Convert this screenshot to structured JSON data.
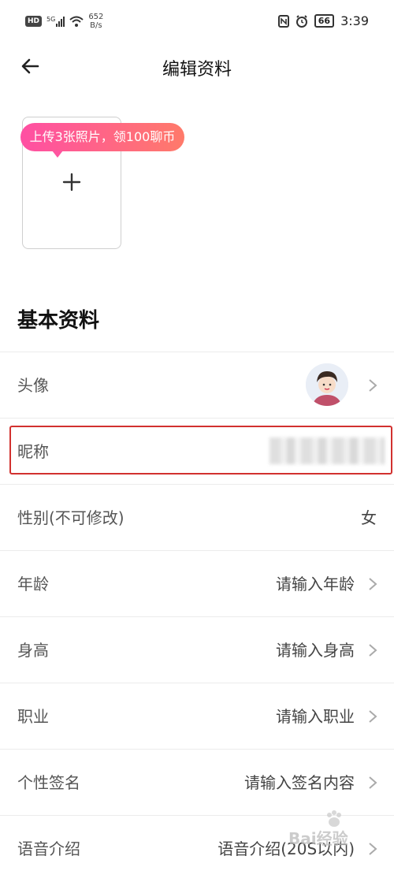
{
  "status_bar": {
    "hd_badge": "HD",
    "network": "5G",
    "speed_value": "652",
    "speed_unit": "B/s",
    "battery": "66",
    "time": "3:39"
  },
  "header": {
    "title": "编辑资料"
  },
  "photo_upload": {
    "tooltip": "上传3张照片，领100聊币"
  },
  "section": {
    "title": "基本资料"
  },
  "fields": [
    {
      "label": "头像",
      "value": ""
    },
    {
      "label": "昵称",
      "value": ""
    },
    {
      "label": "性别(不可修改)",
      "value": "女"
    },
    {
      "label": "年龄",
      "value": "请输入年龄"
    },
    {
      "label": "身高",
      "value": "请输入身高"
    },
    {
      "label": "职业",
      "value": "请输入职业"
    },
    {
      "label": "个性签名",
      "value": "请输入签名内容"
    },
    {
      "label": "语音介绍",
      "value": "语音介绍(20S以内)"
    }
  ],
  "watermark": {
    "text": "Bai经验"
  },
  "colors": {
    "tooltip_gradient_start": "#ff4fa3",
    "tooltip_gradient_end": "#ff7a6a",
    "highlight": "#d2312f"
  }
}
